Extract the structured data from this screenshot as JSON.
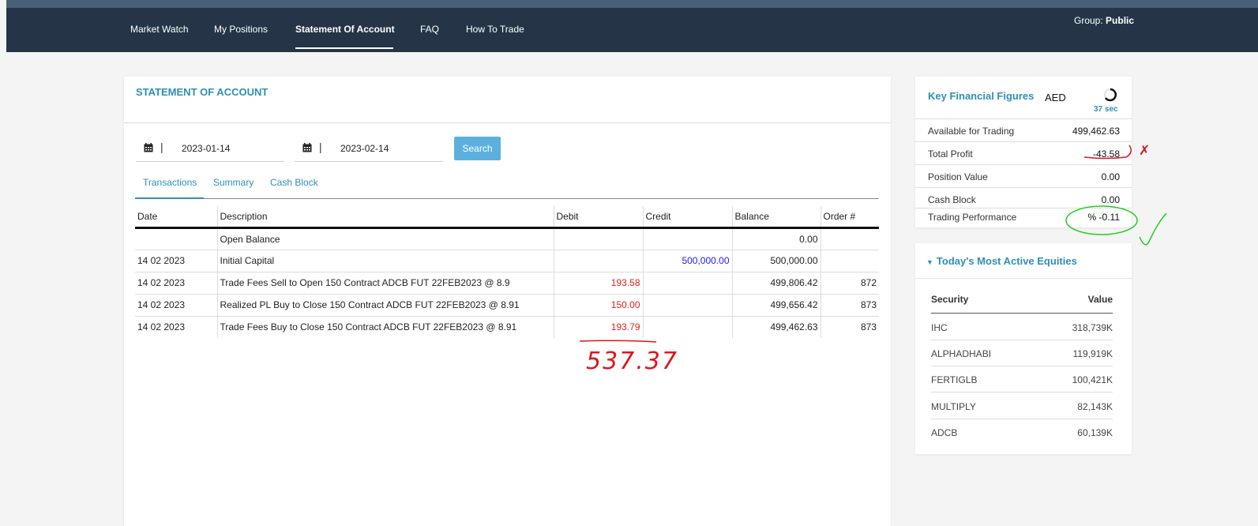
{
  "nav": {
    "items": [
      "Market Watch",
      "My Positions",
      "Statement Of Account",
      "FAQ",
      "How To Trade"
    ],
    "active": "Statement Of Account",
    "group_label": "Group:",
    "group_value": "Public"
  },
  "statement": {
    "title": "STATEMENT OF ACCOUNT",
    "date_from": "2023-01-14",
    "date_to": "2023-02-14",
    "search_label": "Search",
    "tabs": [
      "Transactions",
      "Summary",
      "Cash Block"
    ],
    "active_tab": "Transactions",
    "columns": [
      "Date",
      "Description",
      "Debit",
      "Credit",
      "Balance",
      "Order #"
    ],
    "rows": [
      {
        "date": "",
        "description": "Open Balance",
        "debit": "",
        "credit": "",
        "balance": "0.00",
        "order": ""
      },
      {
        "date": "14 02 2023",
        "description": "Initial Capital",
        "debit": "",
        "credit": "500,000.00",
        "balance": "500,000.00",
        "order": ""
      },
      {
        "date": "14 02 2023",
        "description": "Trade Fees Sell to Open 150 Contract ADCB FUT 22FEB2023 @ 8.9",
        "debit": "193.58",
        "credit": "",
        "balance": "499,806.42",
        "order": "872"
      },
      {
        "date": "14 02 2023",
        "description": "Realized PL Buy to Close 150 Contract ADCB FUT 22FEB2023 @ 8.91",
        "debit": "150.00",
        "credit": "",
        "balance": "499,656.42",
        "order": "873"
      },
      {
        "date": "14 02 2023",
        "description": "Trade Fees Buy to Close 150 Contract ADCB FUT 22FEB2023 @ 8.91",
        "debit": "193.79",
        "credit": "",
        "balance": "499,462.63",
        "order": "873"
      }
    ]
  },
  "key_figures": {
    "title": "Key Financial Figures",
    "currency": "AED",
    "timer": "37 sec",
    "rows": [
      {
        "label": "Available for Trading",
        "value": "499,462.63"
      },
      {
        "label": "Total Profit",
        "value": "-43.58"
      },
      {
        "label": "Position Value",
        "value": "0.00"
      },
      {
        "label": "Cash Block",
        "value": "0.00"
      },
      {
        "label": "Trading Performance",
        "value": "% -0.11"
      }
    ]
  },
  "equities": {
    "title": "Today's Most Active Equities",
    "col_security": "Security",
    "col_value": "Value",
    "rows": [
      {
        "security": "IHC",
        "value": "318,739K"
      },
      {
        "security": "ALPHADHABI",
        "value": "119,919K"
      },
      {
        "security": "FERTIGLB",
        "value": "100,421K"
      },
      {
        "security": "MULTIPLY",
        "value": "82,143K"
      },
      {
        "security": "ADCB",
        "value": "60,139K"
      }
    ]
  },
  "annotation": {
    "handwritten_total": "537.37",
    "cross_mark": "✗",
    "check_mark": "✓",
    "color": "#e0141e",
    "check_color": "#22cc22"
  },
  "colors": {
    "nav_bg": "#253547",
    "accent": "#2d8fb8",
    "debit": "#e02020",
    "credit": "#1a1aff",
    "button": "#5bb0de"
  }
}
